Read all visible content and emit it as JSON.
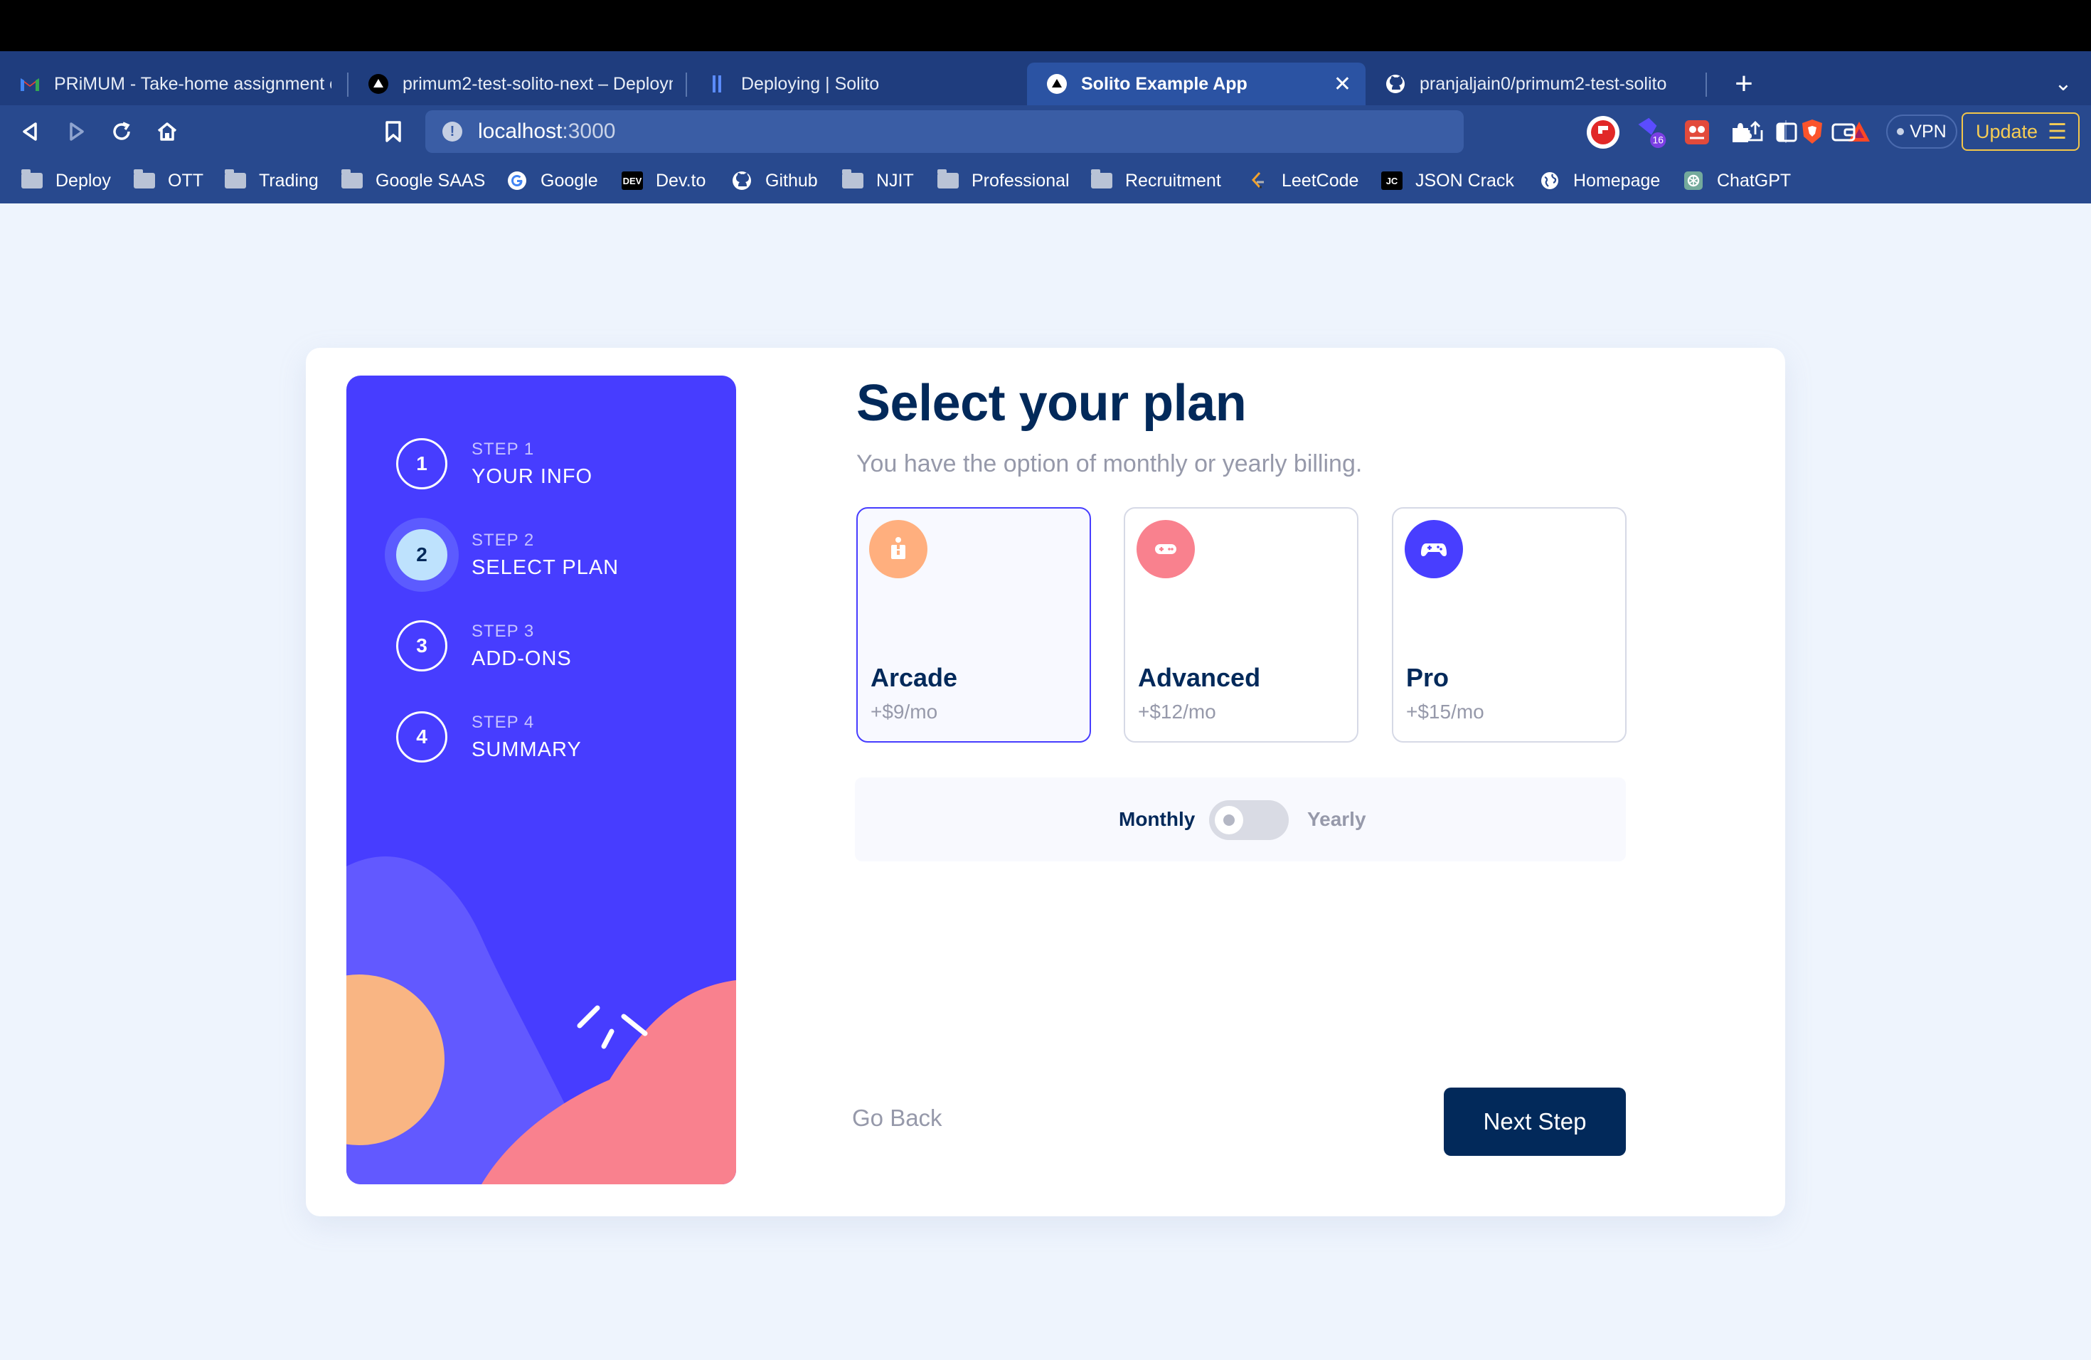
{
  "browser": {
    "tabs": [
      {
        "title": "PRiMUM - Take-home assignment c",
        "active": false
      },
      {
        "title": "primum2-test-solito-next – Deploym",
        "active": false
      },
      {
        "title": "Deploying | Solito",
        "active": false
      },
      {
        "title": "Solito Example App",
        "active": true
      },
      {
        "title": "pranjaljain0/primum2-test-solito",
        "active": false
      }
    ],
    "url_host": "localhost",
    "url_port": ":3000",
    "extension_badge": "16",
    "vpn_label": "VPN",
    "update_label": "Update",
    "bookmarks": [
      {
        "label": "Deploy",
        "icon": "folder-icon"
      },
      {
        "label": "OTT",
        "icon": "folder-icon"
      },
      {
        "label": "Trading",
        "icon": "folder-icon"
      },
      {
        "label": "Google SAAS",
        "icon": "folder-icon"
      },
      {
        "label": "Google",
        "icon": "google-icon"
      },
      {
        "label": "Dev.to",
        "icon": "dev-icon",
        "icon_text": "DEV"
      },
      {
        "label": "Github",
        "icon": "github-icon"
      },
      {
        "label": "NJIT",
        "icon": "folder-icon"
      },
      {
        "label": "Professional",
        "icon": "folder-icon"
      },
      {
        "label": "Recruitment",
        "icon": "folder-icon"
      },
      {
        "label": "LeetCode",
        "icon": "leetcode-icon"
      },
      {
        "label": "JSON Crack",
        "icon": "jsoncrack-icon",
        "icon_text": "JC"
      },
      {
        "label": "Homepage",
        "icon": "globe-icon"
      },
      {
        "label": "ChatGPT",
        "icon": "chatgpt-icon"
      }
    ]
  },
  "steps": [
    {
      "number": "1",
      "label": "STEP 1",
      "name": "YOUR INFO",
      "active": false
    },
    {
      "number": "2",
      "label": "STEP 2",
      "name": "SELECT PLAN",
      "active": true
    },
    {
      "number": "3",
      "label": "STEP 3",
      "name": "ADD-ONS",
      "active": false
    },
    {
      "number": "4",
      "label": "STEP 4",
      "name": "SUMMARY",
      "active": false
    }
  ],
  "main": {
    "title": "Select your plan",
    "subtitle": "You have the option of monthly or yearly billing."
  },
  "plans": [
    {
      "name": "Arcade",
      "price": "+$9/mo",
      "icon": "arcade-icon",
      "color": "#ffaf7e",
      "selected": true
    },
    {
      "name": "Advanced",
      "price": "+$12/mo",
      "icon": "advanced-icon",
      "color": "#f9818e",
      "selected": false
    },
    {
      "name": "Pro",
      "price": "+$15/mo",
      "icon": "pro-icon",
      "color": "#483eff",
      "selected": false
    }
  ],
  "billing": {
    "monthly_label": "Monthly",
    "yearly_label": "Yearly",
    "yearly_selected": false
  },
  "actions": {
    "back_label": "Go Back",
    "next_label": "Next Step"
  },
  "colors": {
    "primary": "#02295a",
    "accent": "#473dff",
    "sidebar": "#473dff",
    "active_step": "#bee2fd"
  }
}
